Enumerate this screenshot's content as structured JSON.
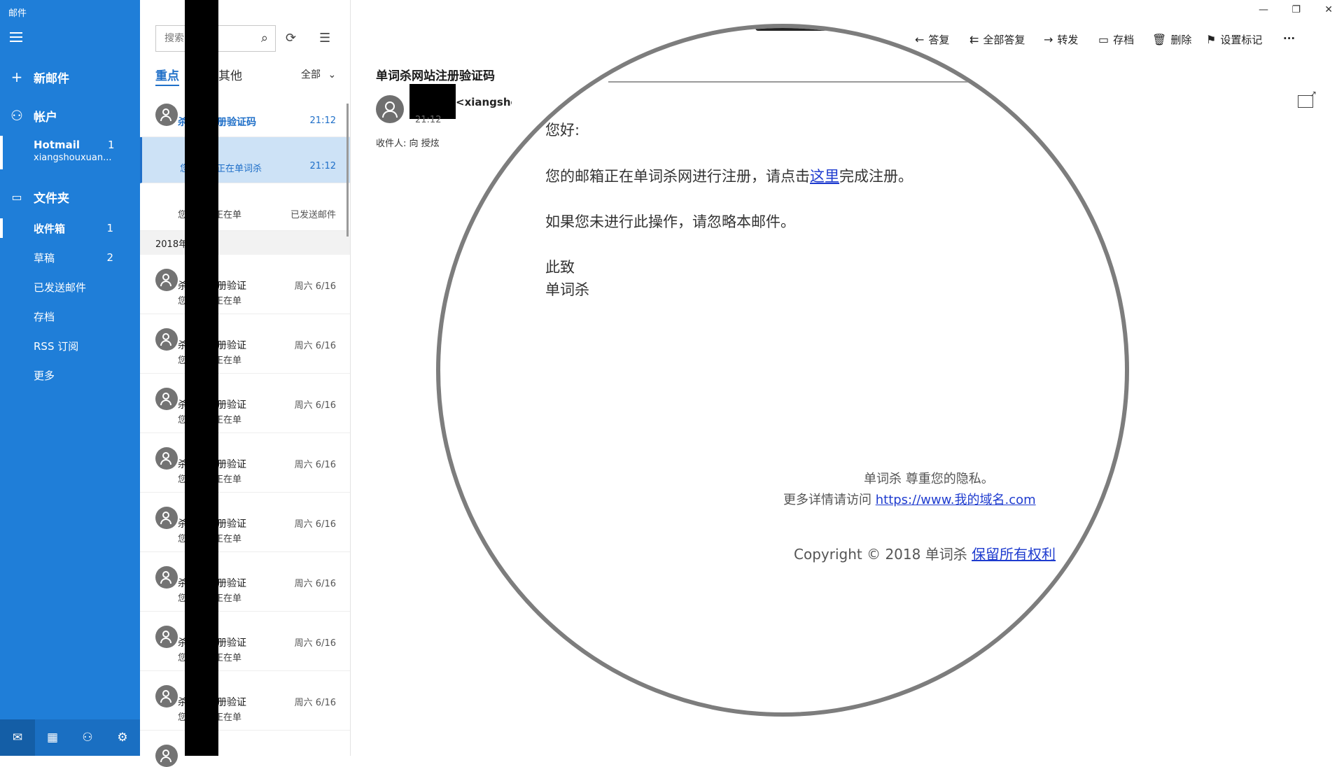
{
  "app": {
    "title": "邮件"
  },
  "nav": {
    "new_mail": "新邮件",
    "accounts_label": "帐户",
    "account": {
      "name": "Hotmail",
      "count": "1",
      "email": "xiangshouxuan..."
    },
    "folders_label": "文件夹",
    "folders": [
      {
        "name": "收件箱",
        "count": "1"
      },
      {
        "name": "草稿",
        "count": "2"
      },
      {
        "name": "已发送邮件",
        "count": ""
      },
      {
        "name": "存档",
        "count": ""
      },
      {
        "name": "RSS 订阅",
        "count": ""
      },
      {
        "name": "更多",
        "count": ""
      }
    ]
  },
  "list": {
    "search_placeholder": "搜索",
    "tab_focused": "重点",
    "tab_other": "其他",
    "filter": "全部",
    "items_top": [
      {
        "subject": "杀网站注册验证码",
        "time": "21:12"
      },
      {
        "preview": "您的邮箱正在单词杀",
        "time": "21:12"
      },
      {
        "preview": "您的邮箱正在单",
        "time": "已发送邮件"
      }
    ],
    "group_header": "2018年",
    "items": [
      {
        "subject": "杀网站注册验证",
        "time": "周六 6/16",
        "preview": "您的邮箱正在单"
      },
      {
        "subject": "杀网站注册验证",
        "time": "周六 6/16",
        "preview": "您的邮箱正在单"
      },
      {
        "subject": "杀网站注册验证",
        "time": "周六 6/16",
        "preview": "您的邮箱正在单"
      },
      {
        "subject": "杀网站注册验证",
        "time": "周六 6/16",
        "preview": "您的邮箱正在单"
      },
      {
        "subject": "杀网站注册验证",
        "time": "周六 6/16",
        "preview": "您的邮箱正在单"
      },
      {
        "subject": "杀网站注册验证",
        "time": "周六 6/16",
        "preview": "您的邮箱正在单"
      },
      {
        "subject": "杀网站注册验证",
        "time": "周六 6/16",
        "preview": "您的邮箱正在单"
      },
      {
        "subject": "杀网站注册验证",
        "time": "周六 6/16",
        "preview": "您的邮箱正在单"
      }
    ]
  },
  "commands": {
    "reply": "答复",
    "reply_all": "全部答复",
    "forward": "转发",
    "archive": "存档",
    "delete": "删除",
    "flag": "设置标记",
    "more": "···"
  },
  "message": {
    "subject": "单词杀网站注册验证码",
    "sender_email": "<xiangshouxuan@ho",
    "time": "21:12",
    "recipients": "收件人: 向 授炫",
    "body": {
      "greeting": "您好:",
      "line1_pre": "您的邮箱正在单词杀网进行注册，请点击",
      "line1_link": "这里",
      "line1_post": "完成注册。",
      "line2": "如果您未进行此操作，请忽略本邮件。",
      "sign1": "此致",
      "sign2": "单词杀",
      "footer1": "单词杀 尊重您的隐私。",
      "footer2_pre": "更多详情请访问 ",
      "footer2_link": "https://www.我的域名.com",
      "footer3_pre": "Copyright © 2018 单词杀 ",
      "footer3_link": "保留所有权利"
    }
  },
  "colors": {
    "nav_bg": "#1f7ed8",
    "accent": "#1f6fc8",
    "link": "#1f3ccf"
  }
}
